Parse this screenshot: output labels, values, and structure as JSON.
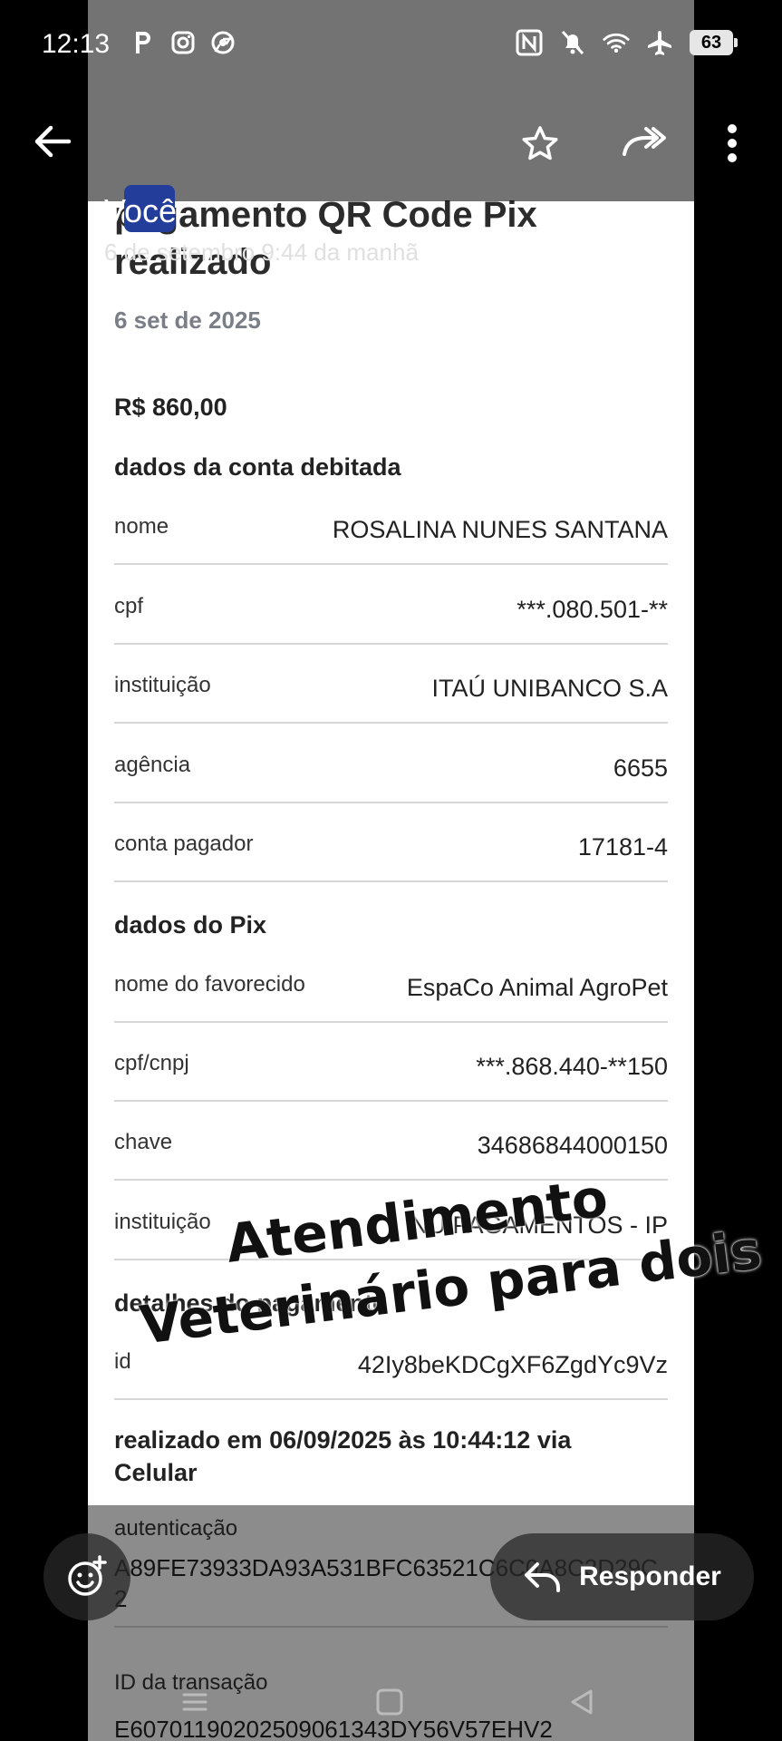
{
  "status_bar": {
    "time": "12:13",
    "left_icons": [
      "parking-app-icon",
      "instagram-icon",
      "chrome-icon"
    ],
    "right_icons": [
      "nfc-icon",
      "bell-muted-icon",
      "wifi-icon",
      "airplane-mode-icon"
    ],
    "battery": "63"
  },
  "header": {
    "sender": "Você",
    "date": "6 de setembro 9:44 da manhã"
  },
  "receipt": {
    "title": "pagamento QR Code Pix realizado",
    "date": "6 set de 2025",
    "amount": "R$ 860,00",
    "debited_section": "dados da conta debitada",
    "debited_rows": [
      {
        "label": "nome",
        "value": "ROSALINA NUNES SANTANA"
      },
      {
        "label": "cpf",
        "value": "***.080.501-**"
      },
      {
        "label": "instituição",
        "value": "ITAÚ UNIBANCO S.A"
      },
      {
        "label": "agência",
        "value": "6655"
      },
      {
        "label": "conta pagador",
        "value": "17181-4"
      }
    ],
    "pix_section": "dados do Pix",
    "pix_rows": [
      {
        "label": "nome do favorecido",
        "value": "EspaCo Animal AgroPet"
      },
      {
        "label": "cpf/cnpj",
        "value": "***.868.440-**150"
      },
      {
        "label": "chave",
        "value": "34686844000150"
      },
      {
        "label": "instituição",
        "value": "NU PAGAMENTOS - IP"
      }
    ],
    "details_section": "detalhes do pagamento",
    "id_label": "id",
    "id_value": "42Iy8beKDCgXF6ZgdYc9Vz",
    "realized": "realizado em 06/09/2025 às 10:44:12 via Celular",
    "auth_label": "autenticação",
    "auth_value": "A89FE73933DA93A531BFC63521C6C0A8C3D29C2",
    "txid_label": "ID da transação",
    "txid_value": "E60701190202509061343DY56V57EHV2"
  },
  "sticker": {
    "line1": "Atendimento",
    "line2": "Veterinário para dois"
  },
  "actions": {
    "reply": "Responder"
  }
}
